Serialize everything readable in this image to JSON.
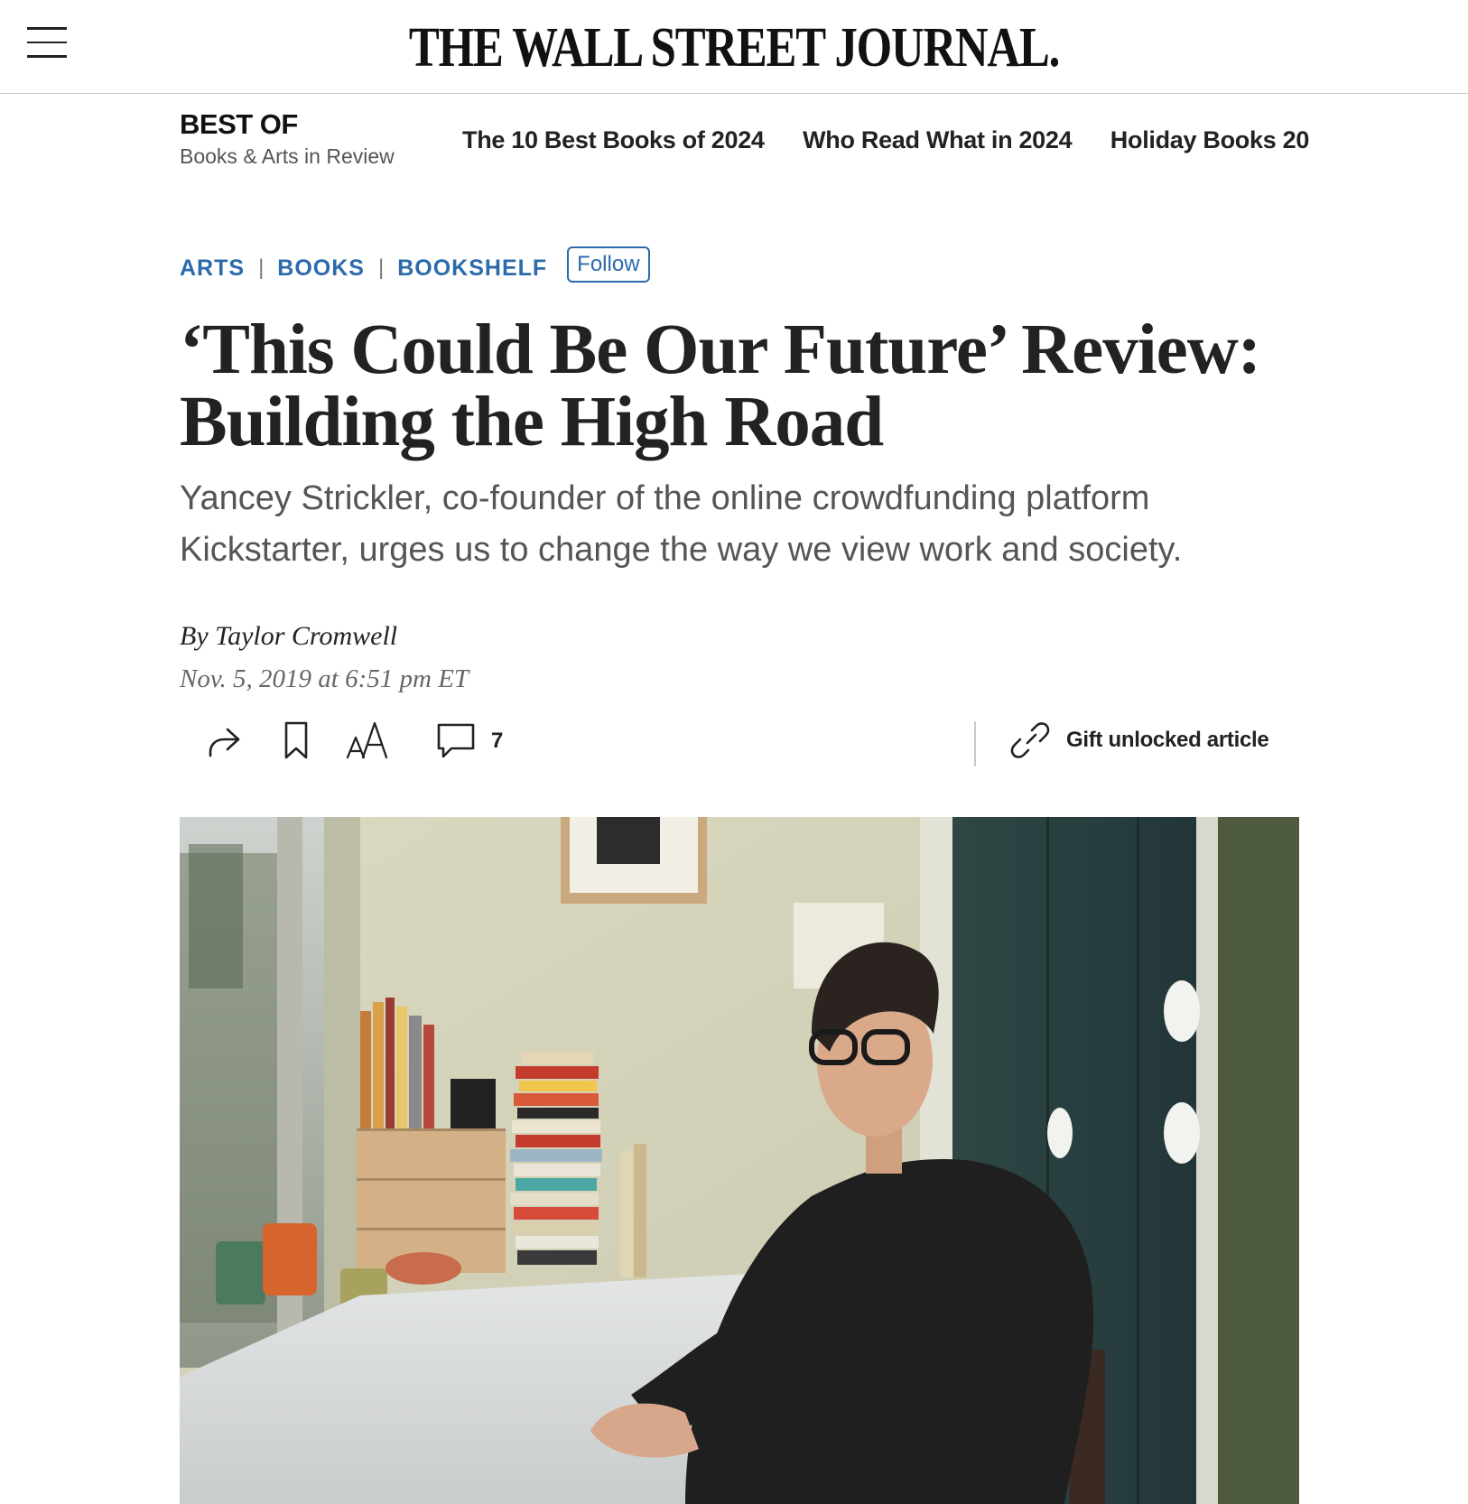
{
  "header": {
    "logo_text": "THE WALL STREET JOURNAL.",
    "menu_icon": "hamburger-menu-icon"
  },
  "best_of": {
    "title": "BEST OF",
    "subtitle": "Books & Arts in Review",
    "links": [
      "The 10 Best Books of 2024",
      "Who Read What in 2024",
      "Holiday Books 20"
    ]
  },
  "flashline": {
    "items": [
      "ARTS",
      "BOOKS",
      "BOOKSHELF"
    ],
    "separator": "|",
    "follow_label": "Follow"
  },
  "article": {
    "headline": "‘This Could Be Our Future’ Review: Building the High Road",
    "dek": "Yancey Strickler, co-founder of the online crowdfunding platform Kickstarter, urges us to change the way we view work and society.",
    "byline_prefix": "By",
    "author": "Taylor Cromwell",
    "timestamp": "Nov. 5, 2019 at 6:51 pm ET"
  },
  "toolbar": {
    "share_icon": "share-icon",
    "bookmark_icon": "bookmark-icon",
    "text_size_icon": "text-size-icon",
    "comment_icon": "comment-icon",
    "comment_count": "7",
    "gift_icon": "link-icon",
    "gift_label": "Gift unlocked article"
  },
  "colors": {
    "flashline_blue": "#2b6aab",
    "text_dark": "#222222",
    "text_gray": "#555555",
    "divider": "#c8c8c8"
  }
}
